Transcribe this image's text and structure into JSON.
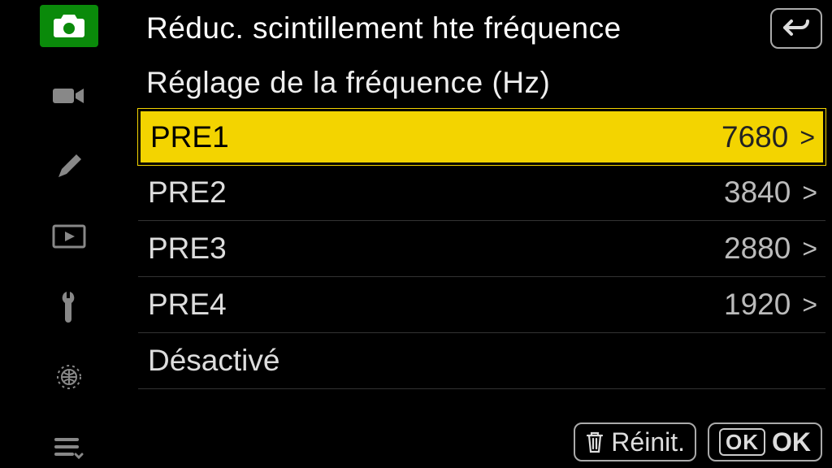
{
  "header": {
    "title": "Réduc. scintillement hte fréquence"
  },
  "subtitle": "Réglage de la fréquence (Hz)",
  "rows": [
    {
      "label": "PRE1",
      "value": "7680",
      "selected": true,
      "has_value": true
    },
    {
      "label": "PRE2",
      "value": "3840",
      "selected": false,
      "has_value": true
    },
    {
      "label": "PRE3",
      "value": "2880",
      "selected": false,
      "has_value": true
    },
    {
      "label": "PRE4",
      "value": "1920",
      "selected": false,
      "has_value": true
    },
    {
      "label": "Désactivé",
      "value": "",
      "selected": false,
      "has_value": false
    }
  ],
  "footer": {
    "reset_label": "Réinit.",
    "ok_box": "OK",
    "ok_label": "OK"
  },
  "sidebar_icons": [
    "camera",
    "video",
    "pencil",
    "playback",
    "wrench",
    "network",
    "mymenu"
  ]
}
